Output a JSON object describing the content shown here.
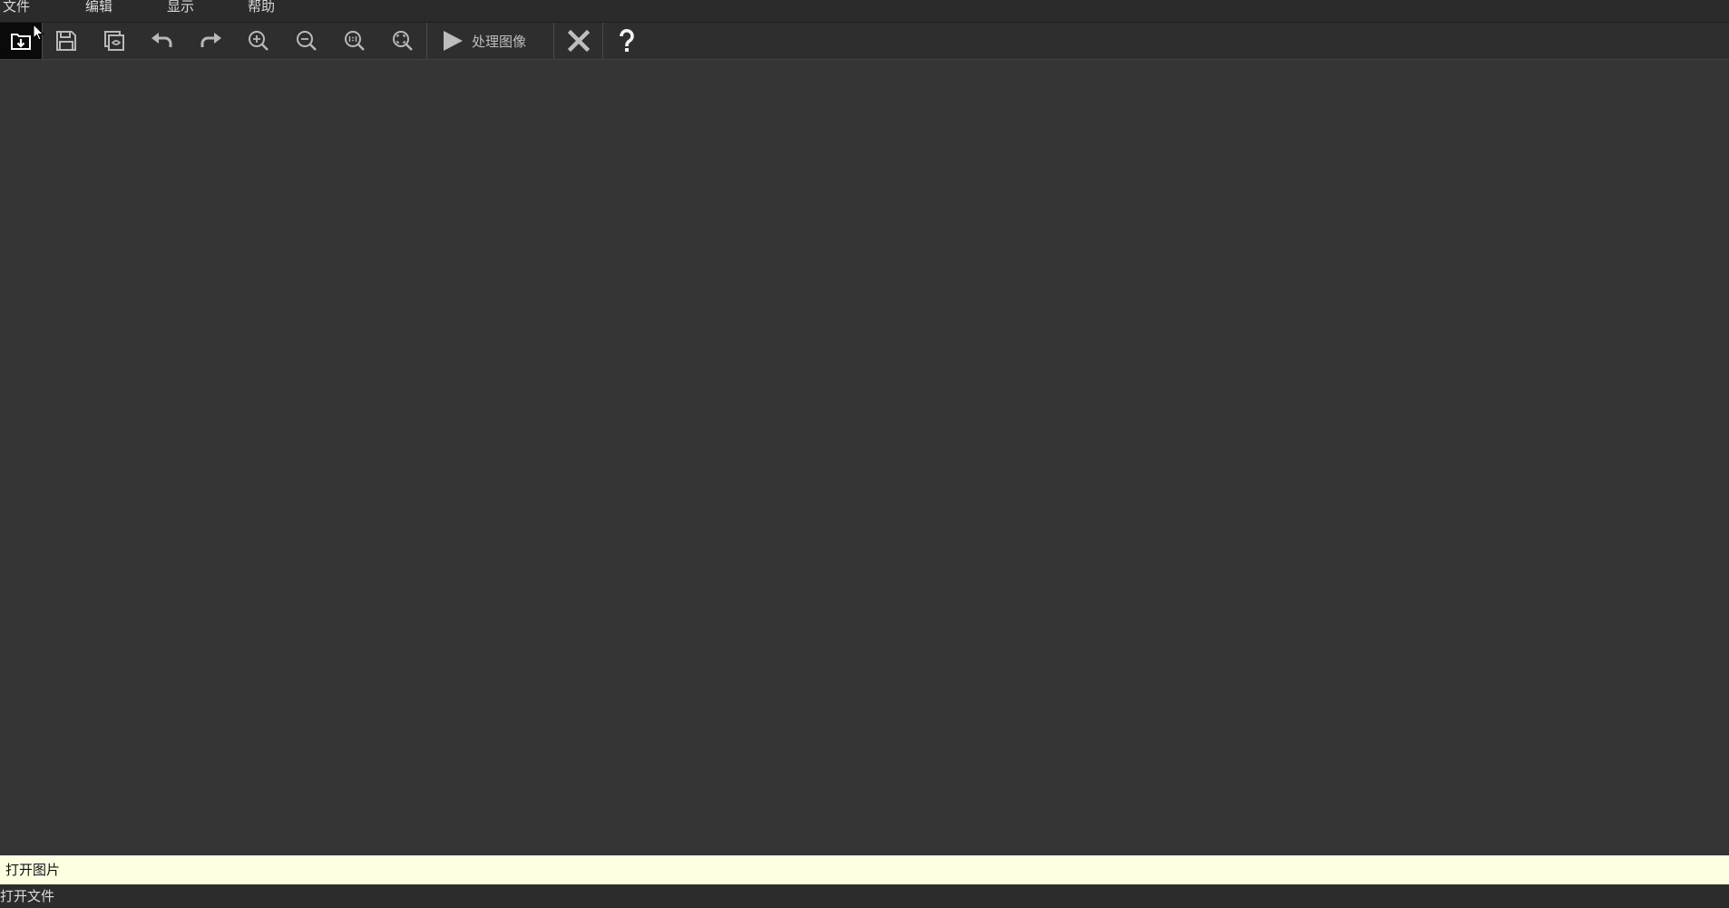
{
  "menubar": {
    "items": [
      {
        "label": "文件"
      },
      {
        "label": "编辑"
      },
      {
        "label": "显示"
      },
      {
        "label": "帮助"
      }
    ]
  },
  "toolbar": {
    "buttons": [
      {
        "name": "open-file",
        "icon": "folder-download-icon",
        "active": true
      },
      {
        "name": "save",
        "icon": "floppy-disk-icon"
      },
      {
        "name": "save-as",
        "icon": "save-as-icon"
      },
      {
        "name": "undo",
        "icon": "undo-icon"
      },
      {
        "name": "redo",
        "icon": "redo-icon"
      },
      {
        "name": "zoom-in",
        "icon": "zoom-in-icon"
      },
      {
        "name": "zoom-out",
        "icon": "zoom-out-icon"
      },
      {
        "name": "zoom-actual",
        "icon": "zoom-1-1-icon"
      },
      {
        "name": "zoom-fit",
        "icon": "zoom-fit-icon"
      }
    ],
    "process_label": "处理图像",
    "close_icon": "close-icon",
    "help_icon": "help-icon"
  },
  "tooltip": {
    "text": "打开图片"
  },
  "statusbar": {
    "text": "打开文件"
  },
  "colors": {
    "background": "#343434",
    "menubar": "#2b2b2b",
    "toolbar": "#2e2e2e",
    "tooltip_bg": "#ffffe1",
    "icon": "#cfcfcf",
    "active_button_bg": "#0a0a0a"
  }
}
